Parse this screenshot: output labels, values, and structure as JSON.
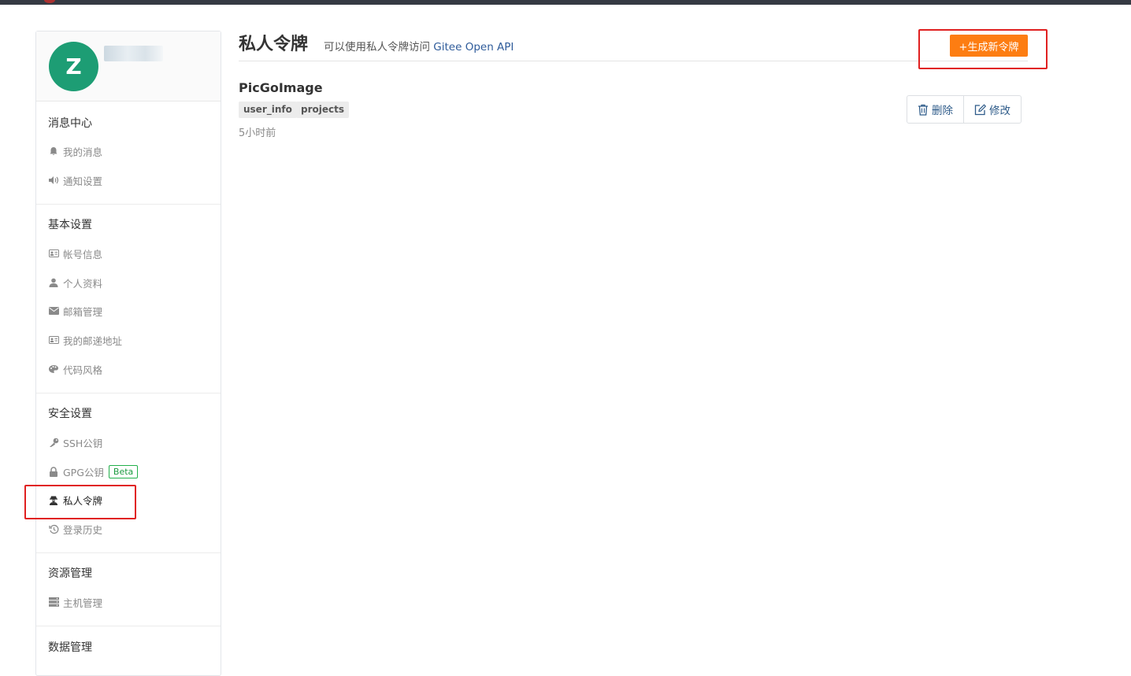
{
  "avatar": {
    "letter": "Z",
    "color": "#1d9d74"
  },
  "sidebar": {
    "sections": [
      {
        "title": "消息中心",
        "items": [
          {
            "label": "我的消息",
            "icon": "bell-icon"
          },
          {
            "label": "通知设置",
            "icon": "volume-icon"
          }
        ]
      },
      {
        "title": "基本设置",
        "items": [
          {
            "label": "帐号信息",
            "icon": "id-card-icon"
          },
          {
            "label": "个人资料",
            "icon": "user-icon"
          },
          {
            "label": "邮箱管理",
            "icon": "mail-icon"
          },
          {
            "label": "我的邮递地址",
            "icon": "address-card-icon"
          },
          {
            "label": "代码风格",
            "icon": "palette-icon"
          }
        ]
      },
      {
        "title": "安全设置",
        "items": [
          {
            "label": "SSH公钥",
            "icon": "key-icon"
          },
          {
            "label": "GPG公钥",
            "icon": "lock-icon",
            "badge": "Beta"
          },
          {
            "label": "私人令牌",
            "icon": "user-secret-icon",
            "active": true
          },
          {
            "label": "登录历史",
            "icon": "history-icon"
          }
        ]
      },
      {
        "title": "资源管理",
        "items": [
          {
            "label": "主机管理",
            "icon": "server-icon"
          }
        ]
      },
      {
        "title": "数据管理",
        "items": []
      }
    ]
  },
  "main": {
    "title": "私人令牌",
    "subtitle_prefix": "可以使用私人令牌访问 ",
    "subtitle_link": "Gitee Open API",
    "generate_button": "+生成新令牌",
    "token": {
      "name": "PicGoImage",
      "scopes": [
        "user_info",
        "projects"
      ],
      "time": "5小时前",
      "delete_label": "删除",
      "edit_label": "修改"
    }
  },
  "colors": {
    "accent": "#fd7d12",
    "highlight": "#e02020",
    "link": "#3a6fb5"
  }
}
